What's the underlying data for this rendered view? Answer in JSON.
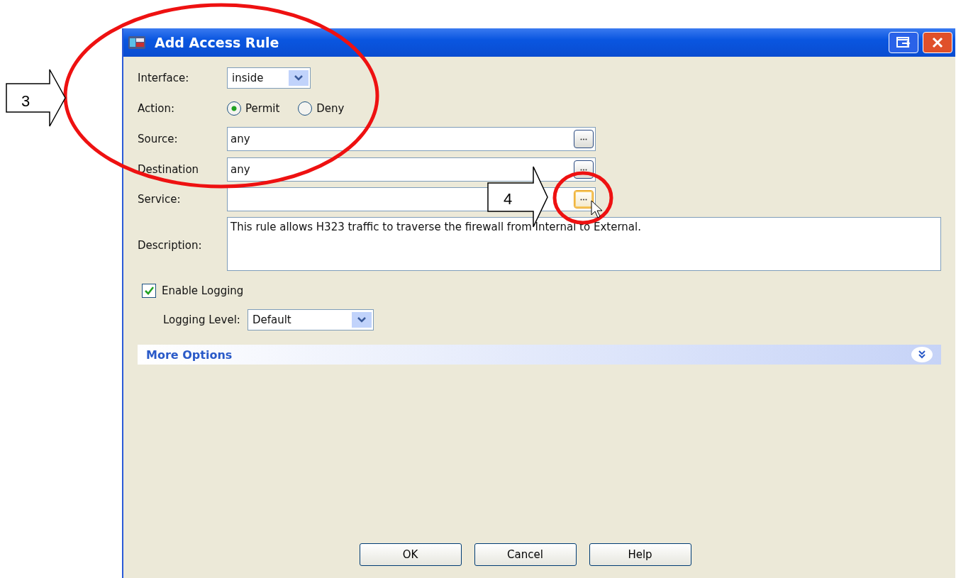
{
  "window": {
    "title": "Add Access Rule"
  },
  "interface": {
    "label": "Interface:",
    "value": "inside"
  },
  "action": {
    "label": "Action:",
    "options": [
      {
        "label": "Permit",
        "selected": true
      },
      {
        "label": "Deny",
        "selected": false
      }
    ]
  },
  "address_fields": [
    {
      "label": "Source:",
      "value": "any",
      "browse_focused": false
    },
    {
      "label": "Destination",
      "value": "any",
      "browse_focused": false
    },
    {
      "label": "Service:",
      "browse_focused": true
    }
  ],
  "description": {
    "label": "Description:",
    "value": "This rule allows H323 traffic to traverse the firewall from Internal to External."
  },
  "logging": {
    "label": "Enable Logging",
    "checked": true
  },
  "logging_level": {
    "label": "Logging Level:",
    "value": "Default"
  },
  "more_options": {
    "label": "More Options",
    "expanded": false
  },
  "buttons": [
    "OK",
    "Cancel",
    "Help"
  ],
  "annotations": [
    {
      "label": "3"
    },
    {
      "label": "4"
    }
  ]
}
